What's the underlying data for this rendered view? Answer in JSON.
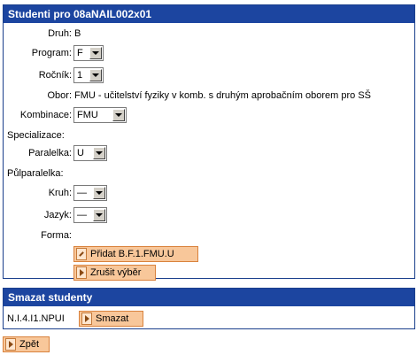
{
  "main_panel": {
    "title": "Studenti pro 08aNAIL002x01",
    "druh": {
      "label": "Druh:",
      "value": "B"
    },
    "program": {
      "label": "Program:",
      "value": "F"
    },
    "rocnik": {
      "label": "Ročník:",
      "value": "1"
    },
    "obor": {
      "label": "Obor:",
      "value": "FMU - učitelství fyziky v komb. s druhým aprobačním oborem pro SŠ"
    },
    "kombinace": {
      "label": "Kombinace:",
      "value": "FMU"
    },
    "specializace": {
      "label": "Specializace:"
    },
    "paralelka": {
      "label": "Paralelka:",
      "value": "U"
    },
    "pulparalelka": {
      "label": "Půlparalelka:"
    },
    "kruh": {
      "label": "Kruh:",
      "value": "—"
    },
    "jazyk": {
      "label": "Jazyk:",
      "value": "—"
    },
    "forma": {
      "label": "Forma:"
    },
    "add_button": "Přidat B.F.1.FMU.U",
    "cancel_button": "Zrušit výběr"
  },
  "delete_panel": {
    "title": "Smazat studenty",
    "item": "N.I.4.I1.NPUI",
    "delete_button": "Smazat"
  },
  "back_button": "Zpět"
}
